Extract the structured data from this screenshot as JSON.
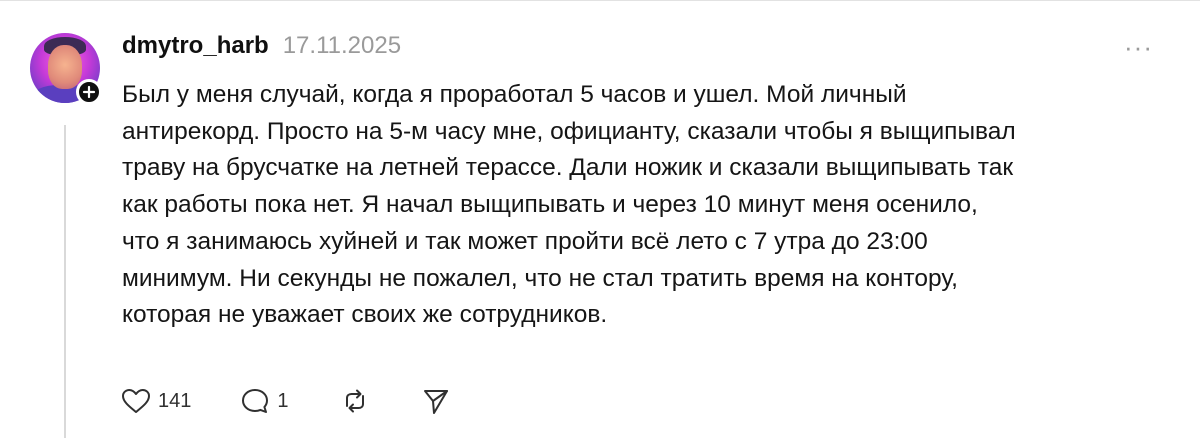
{
  "post": {
    "username": "dmytro_harb",
    "date": "17.11.2025",
    "more_label": "···",
    "text": "Был у меня случай, когда я проработал 5 часов и ушел. Мой личный\nантирекорд. Просто на 5-м часу мне, официанту, сказали чтобы я выщипывал\nтраву на брусчатке на летней терассе. Дали ножик и сказали выщипывать так\nкак работы пока нет. Я начал выщипывать и через 10 минут меня осенило,\nчто я занимаюсь хуйней и так может пройти всё лето с 7 утра до 23:00\nминимум. Ни секунды не пожалел, что не стал тратить время на контору,\nкоторая не уважает своих же сотрудников.",
    "actions": {
      "like_count": "141",
      "reply_count": "1"
    }
  },
  "icons": {
    "like": "heart-icon",
    "reply": "comment-icon",
    "repost": "repost-icon",
    "share": "share-icon",
    "follow": "plus-icon",
    "more": "more-icon"
  }
}
